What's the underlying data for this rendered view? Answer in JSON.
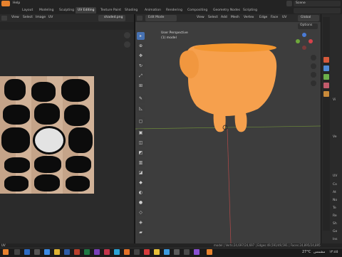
{
  "app": {
    "menu_file": "Help"
  },
  "workspaces": [
    "Layout",
    "Modeling",
    "Sculpting",
    "UV Editing",
    "Texture Paint",
    "Shading",
    "Animation",
    "Rendering",
    "Compositing",
    "Geometry Nodes",
    "Scripting"
  ],
  "active_workspace": "UV Editing",
  "scene_field": "Scene",
  "uv_editor": {
    "menus": [
      "View",
      "Select",
      "Image",
      "UV"
    ],
    "image_name": "shaded.png"
  },
  "viewport": {
    "mode": "Edit Mode",
    "menus": [
      "View",
      "Select",
      "Add",
      "Mesh",
      "Vertex",
      "Edge",
      "Face",
      "UV"
    ],
    "orientation": "Global",
    "options_label": "Options",
    "overlay_line1": "User Perspective",
    "overlay_line2": "(1) model",
    "gizmo_axes": [
      "X",
      "Y",
      "Z"
    ]
  },
  "status_bar": {
    "left": "UV",
    "right": "model | Verts:24,697/24,697 | Edges:49,591/49,591 | Faces:24,895/24,895"
  },
  "taskbar": {
    "temperature": "27°C",
    "weather": "مشمس",
    "time": "١٢:٤٥"
  },
  "properties": {
    "rows": [
      "Vi",
      "Ve",
      "UV",
      "Co",
      "At",
      "No",
      "Te",
      "Re",
      "Sh",
      "Ge",
      "Ins",
      "Ch",
      "Cu"
    ]
  },
  "colors": {
    "accent": "#4772b3",
    "model": "#f6a04d",
    "blender_orange": "#e7822e"
  }
}
